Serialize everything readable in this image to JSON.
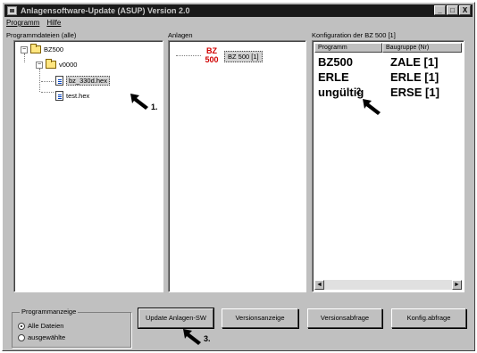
{
  "window": {
    "title": "Anlagensoftware-Update (ASUP) Version 2.0",
    "btn_min": "_",
    "btn_max": "□",
    "btn_close": "X"
  },
  "menu": {
    "programm": "Programm",
    "hilfe": "Hilfe"
  },
  "labels": {
    "programmdateien": "Programmdateien (alle)",
    "anlagen": "Anlagen",
    "konfiguration": "Konfiguration der BZ 500 [1]"
  },
  "tree": {
    "root": "BZ500",
    "version": "v0000",
    "file1": "bz_330d.hex",
    "file2": "test.hex",
    "expander_root": "−",
    "expander_version": "−"
  },
  "anlagen": {
    "logo_line1": "BZ",
    "logo_line2": "500",
    "item": "BZ 500 [1]"
  },
  "config": {
    "columns": [
      "Programm",
      "Baugruppe (Nr)"
    ],
    "rows": [
      {
        "programm": "BZ500",
        "baugruppe": "ZALE [1]"
      },
      {
        "programm": "ERLE",
        "baugruppe": "ERLE [1]"
      },
      {
        "programm": "ungültig",
        "baugruppe": "ERSE [1]"
      }
    ],
    "scroll_left": "◄",
    "scroll_right": "►"
  },
  "programmanzeige": {
    "title": "Programmanzeige",
    "option_all": "Alle Dateien",
    "option_selected": "ausgewählte",
    "selected": "Alle Dateien"
  },
  "buttons": {
    "update": "Update Anlagen-SW",
    "versionsanzeige": "Versionsanzeige",
    "versionsabfrage": "Versionsabfrage",
    "konfigabfrage": "Konfig.abfrage"
  },
  "steps": {
    "step1": "1.",
    "step2": "2.",
    "step3": "3."
  }
}
